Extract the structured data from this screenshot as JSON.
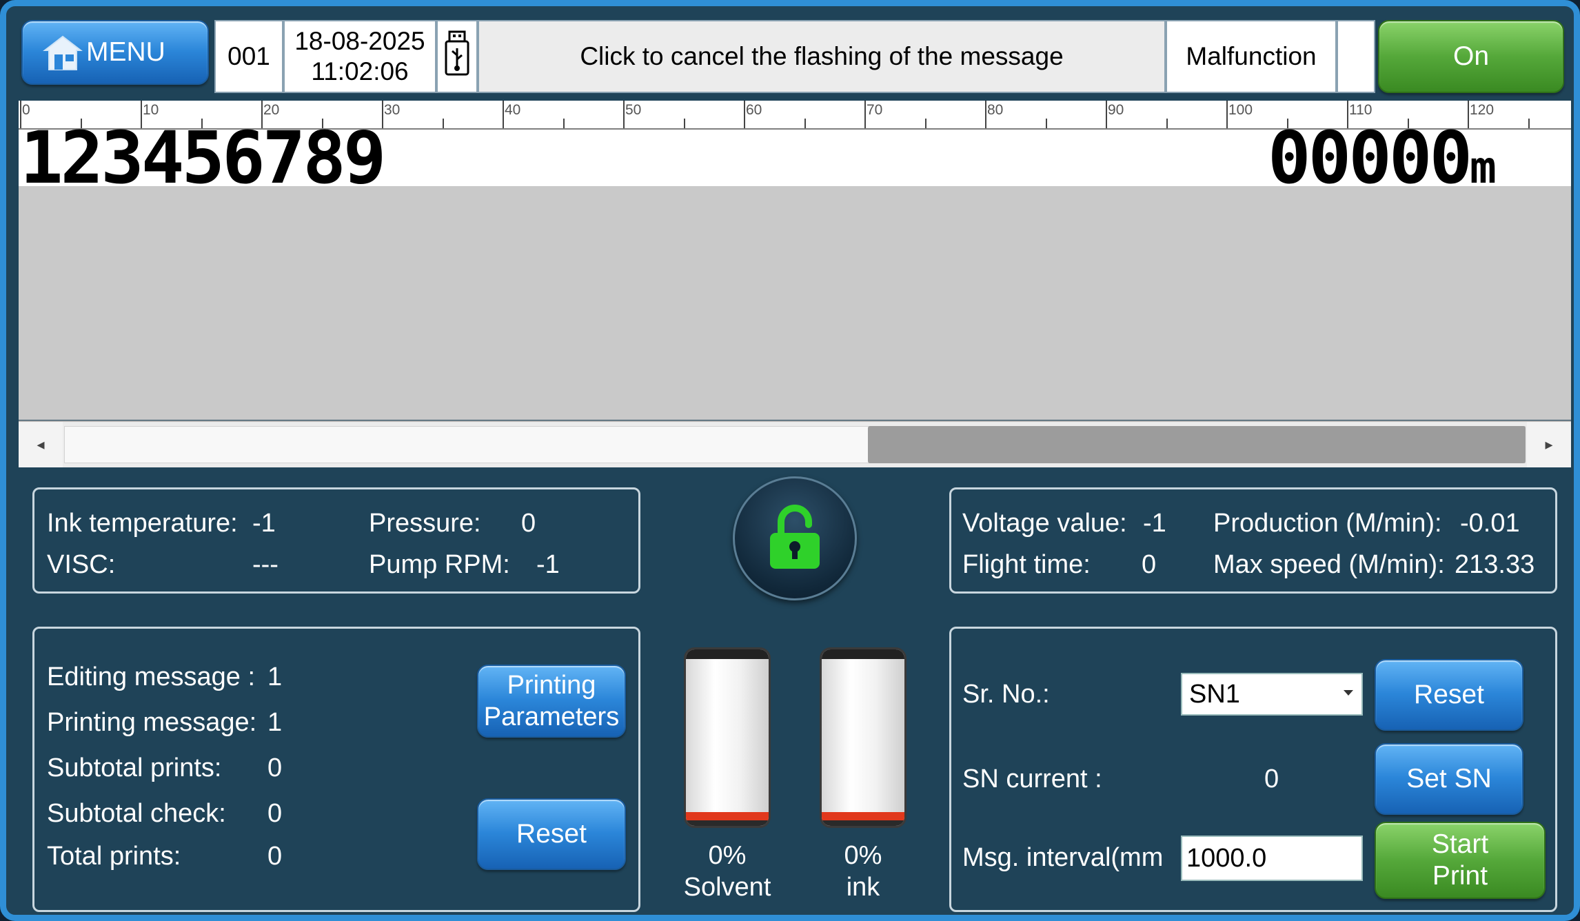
{
  "header": {
    "menu_label": "MENU",
    "job_number": "001",
    "date": "18-08-2025",
    "time": "11:02:06",
    "message": "Click to cancel the flashing of the message",
    "status": "Malfunction",
    "power_label": "On"
  },
  "ruler": {
    "labels": [
      "0",
      "10",
      "20",
      "30",
      "40",
      "50",
      "60",
      "70",
      "80",
      "90",
      "100",
      "110",
      "120"
    ]
  },
  "canvas": {
    "left_text": "123456789",
    "right_text": "00000",
    "right_unit": "m"
  },
  "scrollbar": {
    "left_arrow": "◂",
    "right_arrow": "▸",
    "thumb_start_fraction": 0.55
  },
  "status_left": {
    "ink_temp_label": "Ink temperature:",
    "ink_temp_value": "-1",
    "pressure_label": "Pressure:",
    "pressure_value": "0",
    "visc_label": "VISC:",
    "visc_value": "---",
    "pump_label": "Pump RPM:",
    "pump_value": "-1"
  },
  "status_right": {
    "voltage_label": "Voltage value:",
    "voltage_value": "-1",
    "production_label": "Production (M/min):",
    "production_value": "-0.01",
    "flight_label": "Flight time:",
    "flight_value": "0",
    "max_speed_label": "Max speed (M/min):",
    "max_speed_value": "213.33"
  },
  "lock": {
    "icon": "unlocked-padlock-icon",
    "color": "#2fd12a"
  },
  "counters": {
    "editing_label": "Editing message :",
    "editing_value": "1",
    "printing_label": "Printing message:",
    "printing_value": "1",
    "subtotal_prints_label": "Subtotal prints:",
    "subtotal_prints_value": "0",
    "subtotal_check_label": "Subtotal check:",
    "subtotal_check_value": "0",
    "total_prints_label": "Total prints:",
    "total_prints_value": "0",
    "printing_params_line1": "Printing",
    "printing_params_line2": "Parameters",
    "reset_label": "Reset"
  },
  "tanks": [
    {
      "percent": "0%",
      "name": "Solvent",
      "level": 0
    },
    {
      "percent": "0%",
      "name": "ink",
      "level": 0
    }
  ],
  "serial": {
    "sr_label": "Sr. No.:",
    "sr_value": "SN1",
    "reset_label": "Reset",
    "sn_current_label": "SN current :",
    "sn_current_value": "0",
    "set_sn_label": "Set SN",
    "interval_label": "Msg. interval(mm",
    "interval_value": "1000.0",
    "start_line1": "Start",
    "start_line2": "Print"
  },
  "colors": {
    "frame": "#2f8fd6",
    "background": "#1f4358",
    "button_blue": "#2b86d9",
    "button_green": "#55a83a"
  }
}
